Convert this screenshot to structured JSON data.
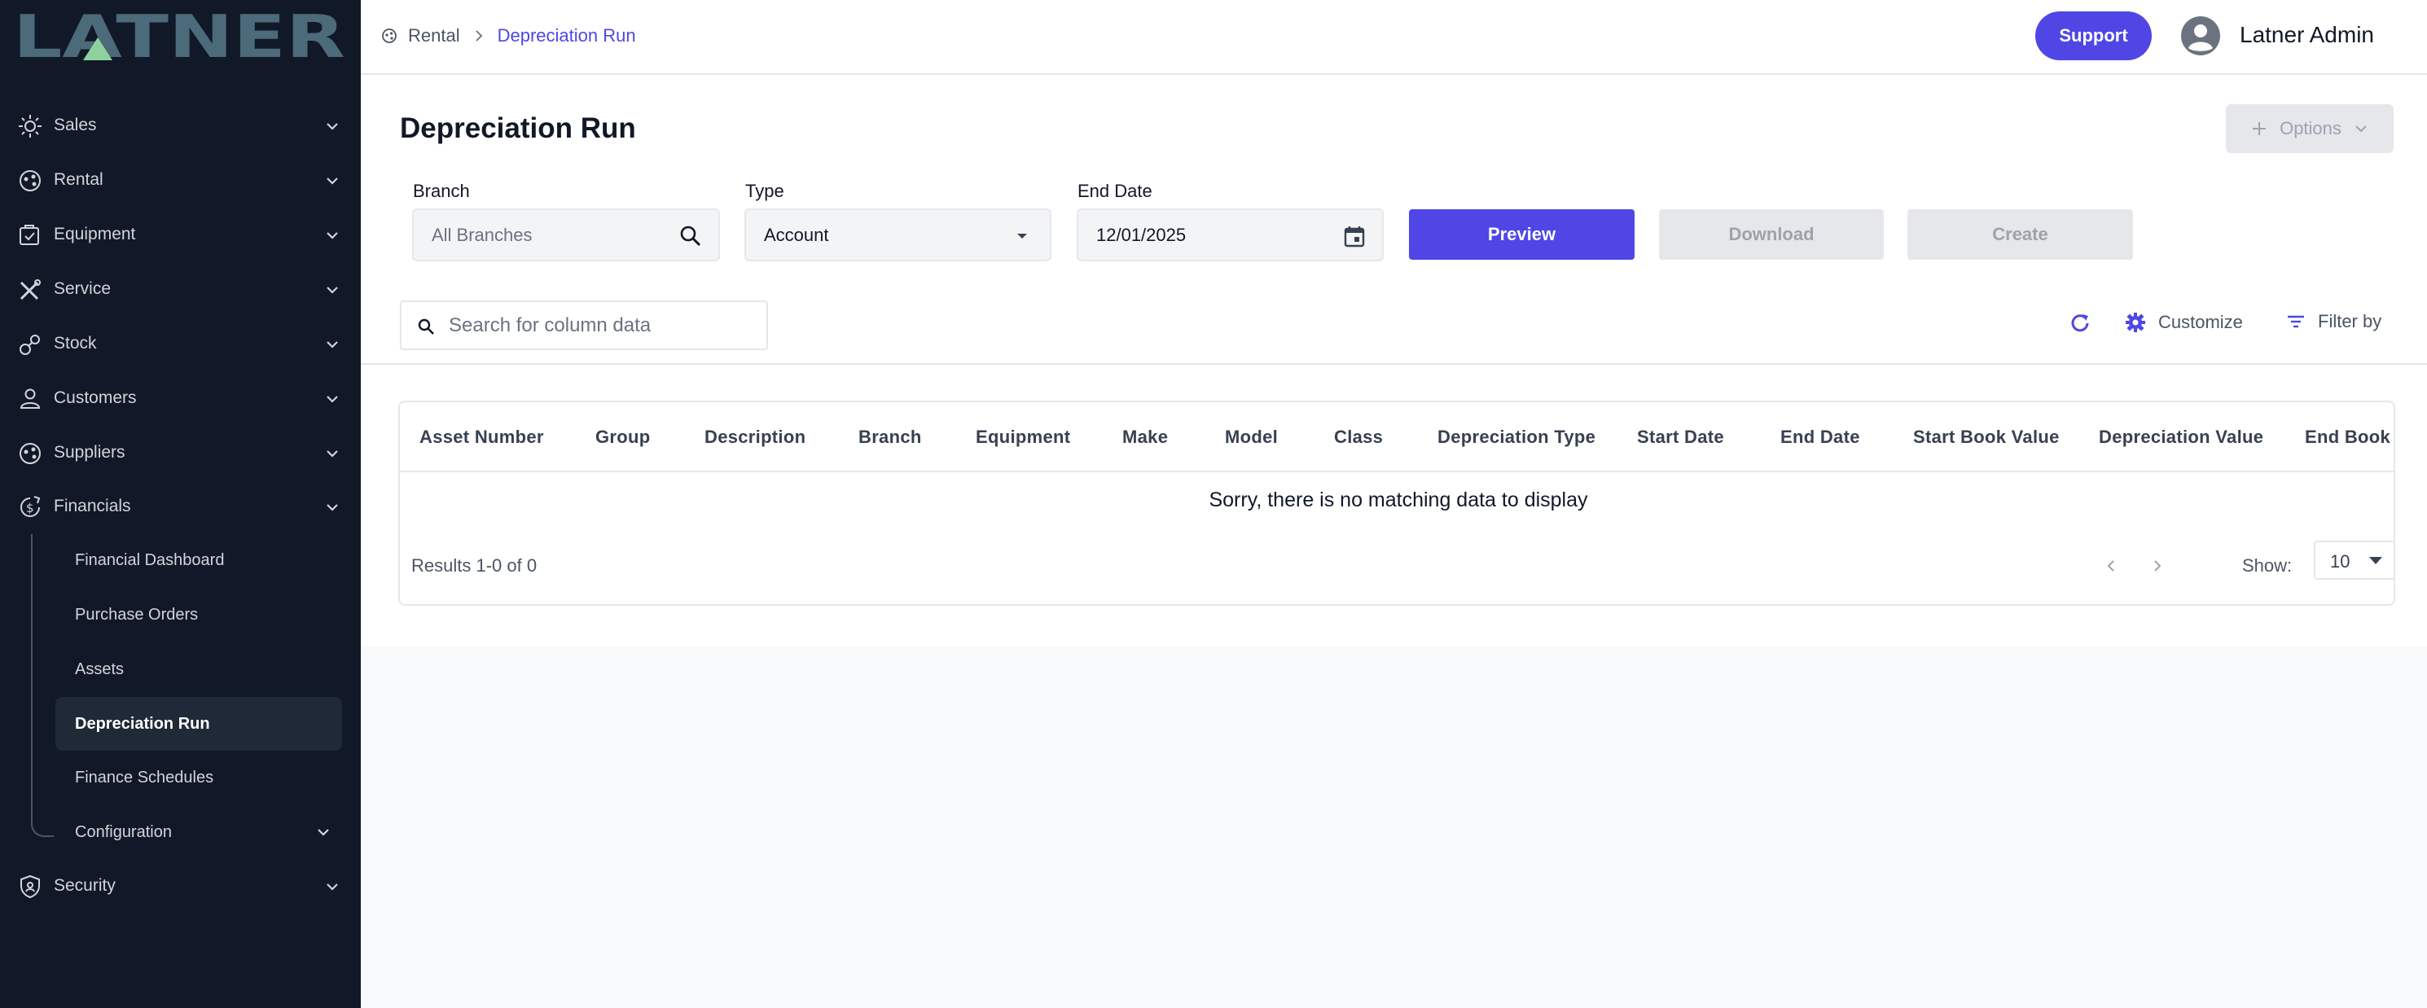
{
  "app": {
    "logo_text": "LATNER",
    "colors": {
      "sidebar_bg": "#111827",
      "accent": "#4f46e5",
      "logo_green": "#8fd19e",
      "logo_text": "#4b6a7a"
    }
  },
  "sidebar": {
    "items": [
      {
        "label": "Sales",
        "icon": "sales-icon"
      },
      {
        "label": "Rental",
        "icon": "rental-icon"
      },
      {
        "label": "Equipment",
        "icon": "equipment-icon"
      },
      {
        "label": "Service",
        "icon": "service-icon"
      },
      {
        "label": "Stock",
        "icon": "stock-icon"
      },
      {
        "label": "Customers",
        "icon": "customers-icon"
      },
      {
        "label": "Suppliers",
        "icon": "suppliers-icon"
      },
      {
        "label": "Financials",
        "icon": "financials-icon",
        "expanded": true
      },
      {
        "label": "Security",
        "icon": "security-icon"
      }
    ],
    "financials_sub": [
      {
        "label": "Financial Dashboard"
      },
      {
        "label": "Purchase Orders"
      },
      {
        "label": "Assets"
      },
      {
        "label": "Depreciation Run",
        "active": true
      },
      {
        "label": "Finance Schedules"
      },
      {
        "label": "Configuration",
        "has_children": true
      }
    ]
  },
  "header": {
    "breadcrumb": [
      "Rental",
      "Depreciation Run"
    ],
    "support_label": "Support",
    "user_name": "Latner Admin"
  },
  "main": {
    "title": "Depreciation Run",
    "options_label": "Options",
    "filters": {
      "branch_label": "Branch",
      "branch_value": "All Branches",
      "type_label": "Type",
      "type_value": "Account",
      "end_date_label": "End Date",
      "end_date_value": "12/01/2025"
    },
    "actions": {
      "preview": "Preview",
      "download": "Download",
      "create": "Create"
    },
    "search": {
      "placeholder": "Search for column data"
    },
    "toolbar": {
      "customize": "Customize",
      "filter_by": "Filter by"
    }
  },
  "table": {
    "columns": [
      "Asset Number",
      "Group",
      "Description",
      "Branch",
      "Equipment",
      "Make",
      "Model",
      "Class",
      "Depreciation Type",
      "Start Date",
      "End Date",
      "Start Book Value",
      "Depreciation Value",
      "End Book Value"
    ],
    "rows": [],
    "empty_message": "Sorry, there is no matching data to display",
    "results_text": "Results 1-0 of 0",
    "show_label": "Show:",
    "page_size": "10"
  }
}
